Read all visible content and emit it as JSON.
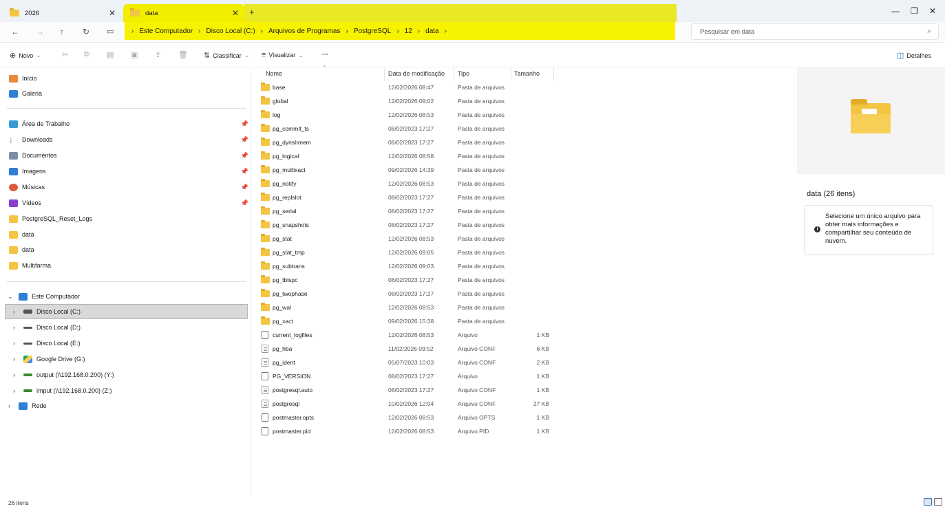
{
  "tabs": [
    {
      "label": "2026"
    },
    {
      "label": "data"
    }
  ],
  "address": {
    "crumbs": [
      "Este Computador",
      "Disco Local (C:)",
      "Arquivos de Programas",
      "PostgreSQL",
      "12",
      "data"
    ],
    "search_placeholder": "Pesquisar em data"
  },
  "toolbar": {
    "new_label": "Novo",
    "sort_label": "Classificar",
    "view_label": "Visualizar",
    "more_label": "···",
    "details_label": "Detalhes"
  },
  "sidebar": {
    "home": "Início",
    "gallery": "Galeria",
    "quick": [
      "Área de Trabalho",
      "Downloads",
      "Documentos",
      "Imagens",
      "Músicas",
      "Vídeos",
      "PostgreSQL_Reset_Logs",
      "data",
      "data",
      "Multifarma"
    ],
    "computer": "Este Computador",
    "drives": [
      "Disco Local (C:)",
      "Disco Local (D:)",
      "Disco Local (E:)",
      "Google Drive (G:)",
      "output (\\\\192.168.0.200) (Y:)",
      "imput (\\\\192.168.0.200) (Z:)"
    ],
    "network": "Rede"
  },
  "columns": {
    "name": "Nome",
    "date": "Data de modificação",
    "type": "Tipo",
    "size": "Tamanho"
  },
  "files": [
    {
      "name": "base",
      "date": "12/02/2026 08:47",
      "type": "Pasta de arquivos",
      "size": "",
      "kind": "folder"
    },
    {
      "name": "global",
      "date": "12/02/2026 09:02",
      "type": "Pasta de arquivos",
      "size": "",
      "kind": "folder"
    },
    {
      "name": "log",
      "date": "12/02/2026 08:53",
      "type": "Pasta de arquivos",
      "size": "",
      "kind": "folder"
    },
    {
      "name": "pg_commit_ts",
      "date": "08/02/2023 17:27",
      "type": "Pasta de arquivos",
      "size": "",
      "kind": "folder"
    },
    {
      "name": "pg_dynshmem",
      "date": "08/02/2023 17:27",
      "type": "Pasta de arquivos",
      "size": "",
      "kind": "folder"
    },
    {
      "name": "pg_logical",
      "date": "12/02/2026 08:58",
      "type": "Pasta de arquivos",
      "size": "",
      "kind": "folder"
    },
    {
      "name": "pg_multixact",
      "date": "09/02/2026 14:39",
      "type": "Pasta de arquivos",
      "size": "",
      "kind": "folder"
    },
    {
      "name": "pg_notify",
      "date": "12/02/2026 08:53",
      "type": "Pasta de arquivos",
      "size": "",
      "kind": "folder"
    },
    {
      "name": "pg_replslot",
      "date": "08/02/2023 17:27",
      "type": "Pasta de arquivos",
      "size": "",
      "kind": "folder"
    },
    {
      "name": "pg_serial",
      "date": "08/02/2023 17:27",
      "type": "Pasta de arquivos",
      "size": "",
      "kind": "folder"
    },
    {
      "name": "pg_snapshots",
      "date": "08/02/2023 17:27",
      "type": "Pasta de arquivos",
      "size": "",
      "kind": "folder"
    },
    {
      "name": "pg_stat",
      "date": "12/02/2026 08:53",
      "type": "Pasta de arquivos",
      "size": "",
      "kind": "folder"
    },
    {
      "name": "pg_stat_tmp",
      "date": "12/02/2026 09:05",
      "type": "Pasta de arquivos",
      "size": "",
      "kind": "folder"
    },
    {
      "name": "pg_subtrans",
      "date": "12/02/2026 09:03",
      "type": "Pasta de arquivos",
      "size": "",
      "kind": "folder"
    },
    {
      "name": "pg_tblspc",
      "date": "08/02/2023 17:27",
      "type": "Pasta de arquivos",
      "size": "",
      "kind": "folder"
    },
    {
      "name": "pg_twophase",
      "date": "08/02/2023 17:27",
      "type": "Pasta de arquivos",
      "size": "",
      "kind": "folder"
    },
    {
      "name": "pg_wal",
      "date": "12/02/2026 08:53",
      "type": "Pasta de arquivos",
      "size": "",
      "kind": "folder"
    },
    {
      "name": "pg_xact",
      "date": "09/02/2026 15:38",
      "type": "Pasta de arquivos",
      "size": "",
      "kind": "folder"
    },
    {
      "name": "current_logfiles",
      "date": "12/02/2026 08:53",
      "type": "Arquivo",
      "size": "1 KB",
      "kind": "file"
    },
    {
      "name": "pg_hba",
      "date": "11/02/2026 09:52",
      "type": "Arquivo CONF",
      "size": "6 KB",
      "kind": "conf"
    },
    {
      "name": "pg_ident",
      "date": "05/07/2023 10:03",
      "type": "Arquivo CONF",
      "size": "2 KB",
      "kind": "conf"
    },
    {
      "name": "PG_VERSION",
      "date": "08/02/2023 17:27",
      "type": "Arquivo",
      "size": "1 KB",
      "kind": "file"
    },
    {
      "name": "postgresql.auto",
      "date": "08/02/2023 17:27",
      "type": "Arquivo CONF",
      "size": "1 KB",
      "kind": "conf"
    },
    {
      "name": "postgresql",
      "date": "10/02/2026 12:04",
      "type": "Arquivo CONF",
      "size": "27 KB",
      "kind": "conf"
    },
    {
      "name": "postmaster.opts",
      "date": "12/02/2026 08:53",
      "type": "Arquivo OPTS",
      "size": "1 KB",
      "kind": "file"
    },
    {
      "name": "postmaster.pid",
      "date": "12/02/2026 08:53",
      "type": "Arquivo PID",
      "size": "1 KB",
      "kind": "file"
    }
  ],
  "details": {
    "title": "data (26 itens)",
    "info": "Selecione um único arquivo para obter mais informações e compartilhar seu conteúdo de nuvem."
  },
  "status": {
    "count": "26 itens"
  },
  "colors": {
    "highlight": "#f7f200",
    "folder": "#f4c542",
    "selected": "#d9d9d9"
  }
}
